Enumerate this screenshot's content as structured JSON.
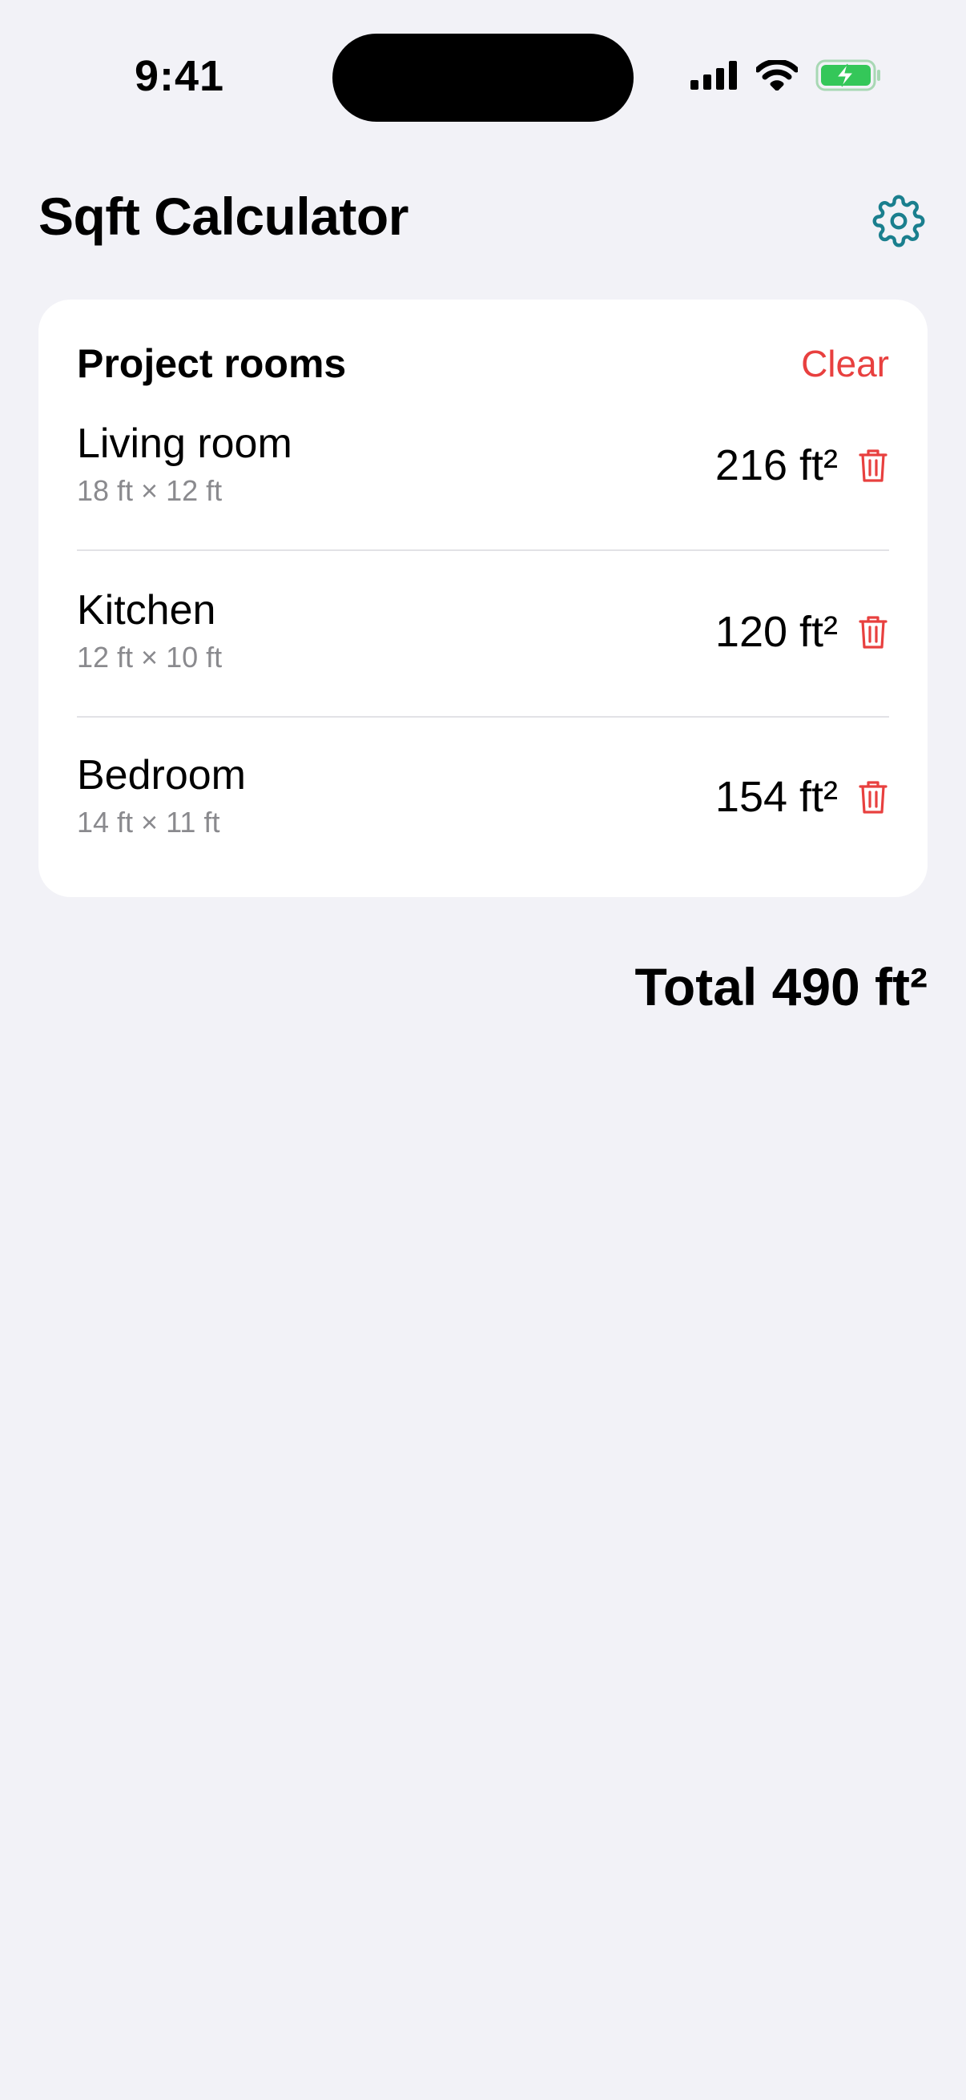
{
  "status_bar": {
    "time": "9:41"
  },
  "header": {
    "title": "Sqft Calculator"
  },
  "card": {
    "title": "Project rooms",
    "clear_label": "Clear"
  },
  "rooms": [
    {
      "name": "Living room",
      "dimensions": "18 ft × 12 ft",
      "area": "216 ft²"
    },
    {
      "name": "Kitchen",
      "dimensions": "12 ft × 10 ft",
      "area": "120 ft²"
    },
    {
      "name": "Bedroom",
      "dimensions": "14 ft × 11 ft",
      "area": "154 ft²"
    }
  ],
  "total": "Total 490 ft²",
  "colors": {
    "accent": "#1A7F8E",
    "destructive": "#E8403F",
    "background": "#F2F2F7",
    "battery": "#34C759"
  },
  "icons": [
    "signal-icon",
    "wifi-icon",
    "battery-charging-icon",
    "gear-icon",
    "trash-icon"
  ]
}
